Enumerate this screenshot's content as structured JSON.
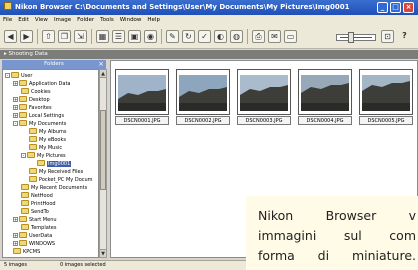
{
  "window": {
    "title": "Nikon Browser C:\\Documents and Settings\\User\\My Documents\\My Pictures\\Img0001",
    "controls": [
      "minimize",
      "maximize",
      "close"
    ]
  },
  "menu": [
    "File",
    "Edit",
    "View",
    "Image",
    "Folder",
    "Tools",
    "Window",
    "Help"
  ],
  "toolbar": {
    "icons": [
      "back-icon",
      "forward-icon",
      "folder-up-icon",
      "copy-icon",
      "export-icon",
      "view-thumbnail-icon",
      "view-list-icon",
      "view-preview-icon",
      "camera-icon",
      "edit-icon",
      "rotate-icon",
      "check-icon",
      "filter-icon",
      "globe-icon",
      "print-icon",
      "email-icon",
      "slideshow-icon"
    ],
    "zoom_level": 0.35,
    "help_label": "?"
  },
  "shooting_data_label": "Shooting Data",
  "folders": {
    "header": "Folders",
    "items": [
      {
        "label": "User",
        "expander": "-",
        "selected": false
      },
      {
        "label": "Application Data",
        "expander": "+",
        "selected": false
      },
      {
        "label": "Cookies",
        "expander": "",
        "selected": false
      },
      {
        "label": "Desktop",
        "expander": "+",
        "selected": false
      },
      {
        "label": "Favorites",
        "expander": "+",
        "selected": false
      },
      {
        "label": "Local Settings",
        "expander": "+",
        "selected": false
      },
      {
        "label": "My Documents",
        "expander": "-",
        "selected": false
      },
      {
        "label": "My Albums",
        "expander": "",
        "selected": false
      },
      {
        "label": "My eBooks",
        "expander": "",
        "selected": false
      },
      {
        "label": "My Music",
        "expander": "",
        "selected": false
      },
      {
        "label": "My Pictures",
        "expander": "-",
        "selected": false
      },
      {
        "label": "Img0001",
        "expander": "",
        "selected": true
      },
      {
        "label": "My Received Files",
        "expander": "",
        "selected": false
      },
      {
        "label": "Pocket_PC My Docum",
        "expander": "",
        "selected": false
      },
      {
        "label": "My Recent Documents",
        "expander": "",
        "selected": false
      },
      {
        "label": "NetHood",
        "expander": "",
        "selected": false
      },
      {
        "label": "PrintHood",
        "expander": "",
        "selected": false
      },
      {
        "label": "SendTo",
        "expander": "",
        "selected": false
      },
      {
        "label": "Start Menu",
        "expander": "+",
        "selected": false
      },
      {
        "label": "Templates",
        "expander": "",
        "selected": false
      },
      {
        "label": "UserData",
        "expander": "+",
        "selected": false
      },
      {
        "label": "WINDOWS",
        "expander": "+",
        "selected": false
      },
      {
        "label": "KPCMS",
        "expander": "",
        "selected": false
      }
    ]
  },
  "thumbnails": [
    {
      "filename": "DSCN0001.JPG"
    },
    {
      "filename": "DSCN0002.JPG"
    },
    {
      "filename": "DSCN0003.JPG"
    },
    {
      "filename": "DSCN0004.JPG"
    },
    {
      "filename": "DSCN0005.JPG"
    }
  ],
  "status": {
    "count": "5 images",
    "selected": "0 images selected"
  },
  "note": {
    "line1": "Nikon Browser v",
    "line2": "immagini sul com",
    "line3": "forma di miniature."
  }
}
